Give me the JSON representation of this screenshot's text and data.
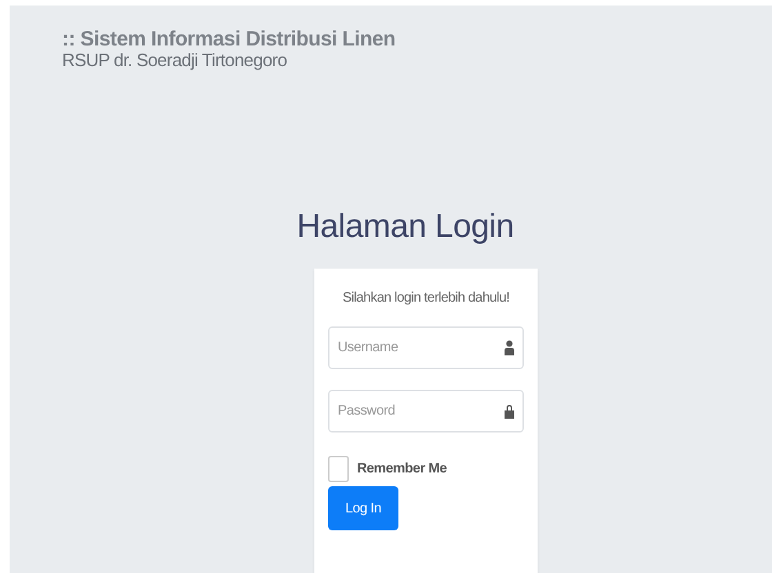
{
  "header": {
    "title": ":: Sistem Informasi Distribusi Linen",
    "subtitle": "RSUP dr. Soeradji Tirtonegoro"
  },
  "page_title": "Halaman Login",
  "login_card": {
    "message": "Silahkan login terlebih dahulu!",
    "fields": [
      {
        "kind": "user",
        "placeholder": "Username"
      },
      {
        "kind": "password",
        "placeholder": "Password"
      }
    ],
    "remember": {
      "label": "Remember Me",
      "checked": false
    },
    "button": "Log In"
  }
}
